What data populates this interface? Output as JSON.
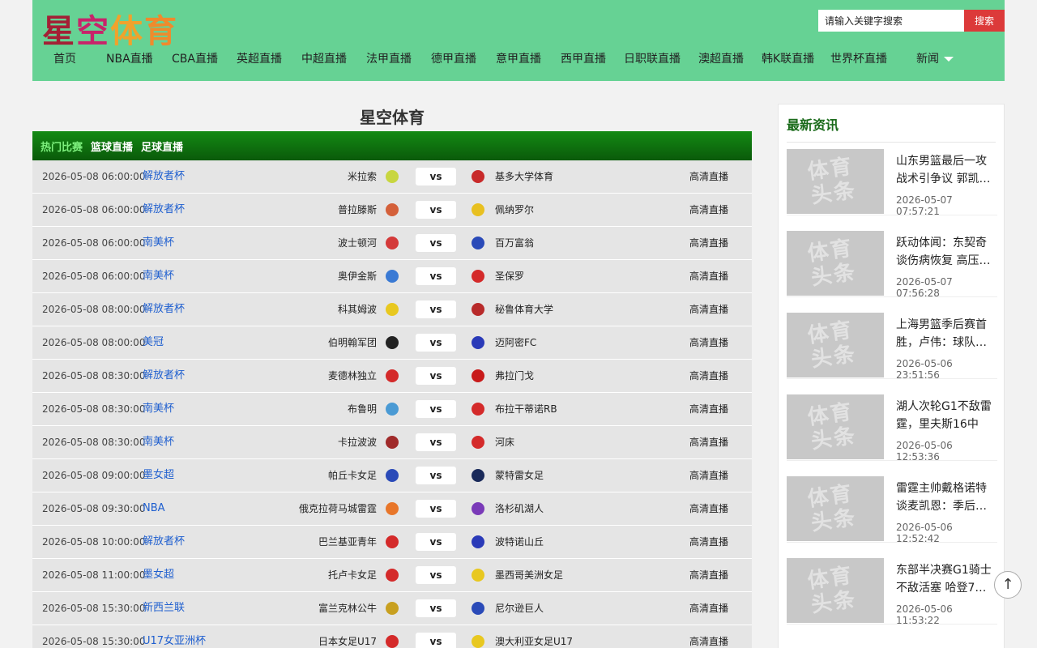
{
  "logo_chars": [
    "星",
    "空",
    "体",
    "育"
  ],
  "search": {
    "placeholder": "请输入关键字搜索",
    "button": "搜索"
  },
  "nav": [
    "首页",
    "NBA直播",
    "CBA直播",
    "英超直播",
    "中超直播",
    "法甲直播",
    "德甲直播",
    "意甲直播",
    "西甲直播",
    "日职联直播",
    "澳超直播",
    "韩K联直播",
    "世界杯直播",
    "新闻"
  ],
  "main": {
    "title": "星空体育",
    "tabs": [
      "热门比赛",
      "篮球直播",
      "足球直播"
    ],
    "matches": [
      {
        "time": "2026-05-08 06:00:00",
        "league": "解放者杯",
        "home": "米拉索",
        "away": "基多大学体育",
        "hc": "#c8d640",
        "ac": "#c82a2a",
        "live": "高清直播"
      },
      {
        "time": "2026-05-08 06:00:00",
        "league": "解放者杯",
        "home": "普拉滕斯",
        "away": "佩纳罗尔",
        "hc": "#d4603a",
        "ac": "#e8c020",
        "live": "高清直播"
      },
      {
        "time": "2026-05-08 06:00:00",
        "league": "南美杯",
        "home": "波士顿河",
        "away": "百万富翁",
        "hc": "#d43a3a",
        "ac": "#2a4ab8",
        "live": "高清直播"
      },
      {
        "time": "2026-05-08 06:00:00",
        "league": "南美杯",
        "home": "奥伊金斯",
        "away": "圣保罗",
        "hc": "#3a7ad4",
        "ac": "#d42a2a",
        "live": "高清直播"
      },
      {
        "time": "2026-05-08 08:00:00",
        "league": "解放者杯",
        "home": "科其姆波",
        "away": "秘鲁体育大学",
        "hc": "#e8c820",
        "ac": "#b82a2a",
        "live": "高清直播"
      },
      {
        "time": "2026-05-08 08:00:00",
        "league": "美冠",
        "home": "伯明翰军团",
        "away": "迈阿密FC",
        "hc": "#222222",
        "ac": "#2a3ab8",
        "live": "高清直播"
      },
      {
        "time": "2026-05-08 08:30:00",
        "league": "解放者杯",
        "home": "麦德林独立",
        "away": "弗拉门戈",
        "hc": "#d42a2a",
        "ac": "#c81a1a",
        "live": "高清直播"
      },
      {
        "time": "2026-05-08 08:30:00",
        "league": "南美杯",
        "home": "布鲁明",
        "away": "布拉干蒂诺RB",
        "hc": "#4a9ad4",
        "ac": "#d42a2a",
        "live": "高清直播"
      },
      {
        "time": "2026-05-08 08:30:00",
        "league": "南美杯",
        "home": "卡拉波波",
        "away": "河床",
        "hc": "#a02a2a",
        "ac": "#d42a2a",
        "live": "高清直播"
      },
      {
        "time": "2026-05-08 09:00:00",
        "league": "墨女超",
        "home": "帕丘卡女足",
        "away": "蒙特雷女足",
        "hc": "#2a4ab8",
        "ac": "#1a2a5a",
        "live": "高清直播"
      },
      {
        "time": "2026-05-08 09:30:00",
        "league": "NBA",
        "home": "俄克拉荷马城雷霆",
        "away": "洛杉矶湖人",
        "hc": "#e8762a",
        "ac": "#7a3ab8",
        "live": "高清直播"
      },
      {
        "time": "2026-05-08 10:00:00",
        "league": "解放者杯",
        "home": "巴兰基亚青年",
        "away": "波特诺山丘",
        "hc": "#d42a2a",
        "ac": "#2a3ab8",
        "live": "高清直播"
      },
      {
        "time": "2026-05-08 11:00:00",
        "league": "墨女超",
        "home": "托卢卡女足",
        "away": "墨西哥美洲女足",
        "hc": "#d42a2a",
        "ac": "#e8c820",
        "live": "高清直播"
      },
      {
        "time": "2026-05-08 15:30:00",
        "league": "新西兰联",
        "home": "富兰克林公牛",
        "away": "尼尔逊巨人",
        "hc": "#c8a020",
        "ac": "#2a4ab8",
        "live": "高清直播"
      },
      {
        "time": "2026-05-08 15:30:00",
        "league": "U17女亚洲杯",
        "home": "日本女足U17",
        "away": "澳大利亚女足U17",
        "hc": "#d42a2a",
        "ac": "#e8c820",
        "live": "高清直播"
      }
    ]
  },
  "sidebar": {
    "title": "最新资讯",
    "thumb_text": "体育头条",
    "news": [
      {
        "title": "山东男篮最后一攻战术引争议 郭凯…",
        "time": "2026-05-07 07:57:21"
      },
      {
        "title": "跃动体闻：东契奇谈伤病恢复 高压…",
        "time": "2026-05-07 07:56:28"
      },
      {
        "title": "上海男篮季后赛首胜，卢伟：球队…",
        "time": "2026-05-06 23:51:56"
      },
      {
        "title": "湖人次轮G1不敌雷霆，里夫斯16中3…",
        "time": "2026-05-06 12:53:36"
      },
      {
        "title": "雷霆主帅戴格诺特谈麦凯恩：季后…",
        "time": "2026-05-06 12:52:42"
      },
      {
        "title": "东部半决赛G1骑士不敌活塞 哈登7…",
        "time": "2026-05-06 11:53:22"
      }
    ]
  }
}
